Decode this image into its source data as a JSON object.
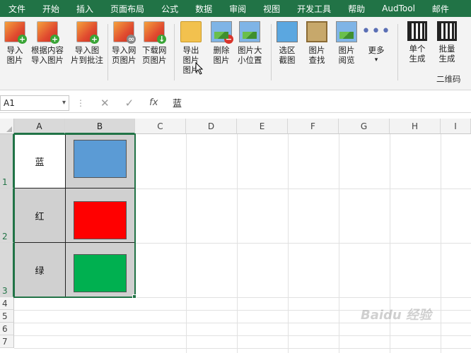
{
  "menu": [
    "文件",
    "开始",
    "插入",
    "页面布局",
    "公式",
    "数据",
    "审阅",
    "视图",
    "开发工具",
    "帮助",
    "AudTool",
    "邮件"
  ],
  "ribbon": {
    "buttons": [
      {
        "label1": "导入",
        "label2": "图片"
      },
      {
        "label1": "根据内容",
        "label2": "导入图片"
      },
      {
        "label1": "导入图",
        "label2": "片到批注"
      },
      {
        "label1": "导入网",
        "label2": "页图片"
      },
      {
        "label1": "下载网",
        "label2": "页图片"
      },
      {
        "label1": "导出",
        "label2": "图片",
        "label3": "图片"
      },
      {
        "label1": "删除",
        "label2": "图片"
      },
      {
        "label1": "图片大",
        "label2": "小位置"
      },
      {
        "label1": "选区",
        "label2": "截图"
      },
      {
        "label1": "图片",
        "label2": "查找"
      },
      {
        "label1": "图片",
        "label2": "阅览"
      },
      {
        "label1": "更多",
        "label2": "▾"
      },
      {
        "label1": "单个",
        "label2": "生成"
      },
      {
        "label1": "批量",
        "label2": "生成"
      }
    ],
    "group_label": "二维码"
  },
  "formula_bar": {
    "name_box": "A1",
    "fx": "fx",
    "value": "蓝"
  },
  "columns": [
    "A",
    "B",
    "C",
    "D",
    "E",
    "F",
    "G",
    "H",
    "I"
  ],
  "rows": [
    "1",
    "2",
    "3",
    "4",
    "5",
    "6",
    "7"
  ],
  "cells": [
    {
      "label": "蓝",
      "color": "#5b9bd5"
    },
    {
      "label": "红",
      "color": "#ff0000"
    },
    {
      "label": "绿",
      "color": "#00b050"
    }
  ],
  "watermark": "Baidu 经验"
}
